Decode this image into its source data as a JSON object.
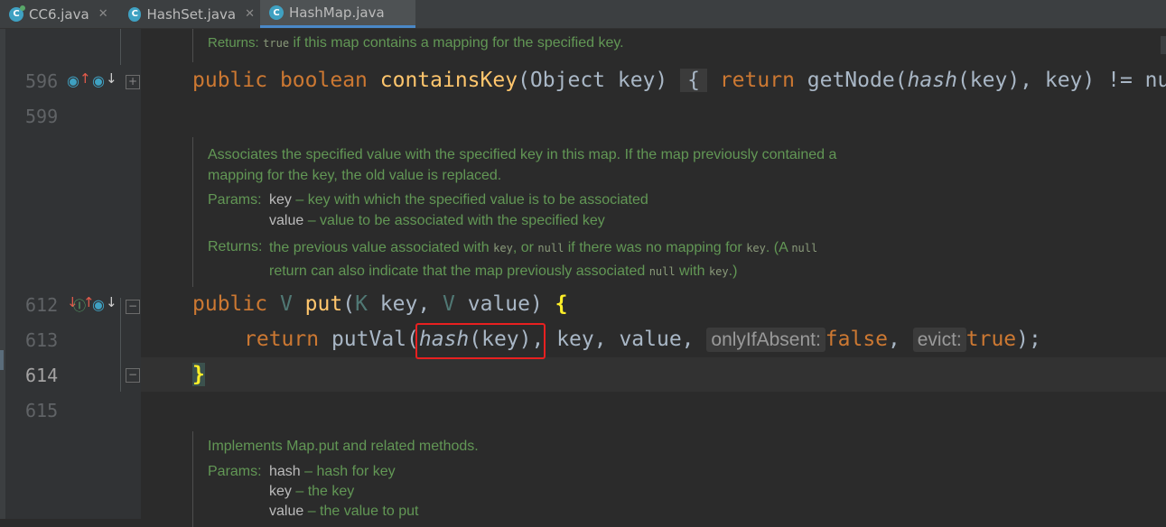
{
  "tabs": [
    {
      "label": "CC6.java",
      "icon": "java-class-icon",
      "active": false
    },
    {
      "label": "HashSet.java",
      "icon": "java-class-icon",
      "active": false
    },
    {
      "label": "HashMap.java",
      "icon": "java-class-icon",
      "active": true
    }
  ],
  "gutter": {
    "lines": [
      "596",
      "599",
      "612",
      "613",
      "614",
      "615"
    ]
  },
  "doc1": {
    "returns_label": "Returns:",
    "returns_code": "true",
    "returns_text": " if this map contains a mapping for the specified key."
  },
  "code596": {
    "kw1": "public",
    "kw2": "boolean",
    "name": "containsKey",
    "params": "(Object key)",
    "fold": "{",
    "kw3": "return",
    "body1": " getNode(",
    "call": "hash",
    "body2": "(key), key) != nu"
  },
  "doc2": {
    "desc1": "Associates the specified value with the specified key in this map. If the map previously contained a",
    "desc2": "mapping for the key, the old value is replaced.",
    "params_label": "Params:",
    "p1_name": "key",
    "p1_desc": " – key with which the specified value is to be associated",
    "p2_name": "value",
    "p2_desc": " – value to be associated with the specified key",
    "returns_label": "Returns:",
    "r1a": "the previous value associated with ",
    "r1_code1": "key",
    "r1b": ", or ",
    "r1_code2": "null",
    "r1c": " if there was no mapping for ",
    "r1_code3": "key",
    "r1d": ". (A ",
    "r1_code4": "null",
    "r2a": "return can also indicate that the map previously associated ",
    "r2_code1": "null",
    "r2b": " with ",
    "r2_code2": "key",
    "r2c": ".)"
  },
  "code612": {
    "kw1": "public",
    "type1": "V",
    "name": "put",
    "p_open": "(",
    "type2": "K",
    "p_key": " key, ",
    "type3": "V",
    "p_val": " value) ",
    "brace": "{"
  },
  "code613": {
    "kw": "return",
    "call": " putVal(",
    "hash": "hash",
    "hash_args": "(key)",
    "rest": ", key, value, ",
    "hint1": "onlyIfAbsent:",
    "v1": "false",
    "sep": ", ",
    "hint2": "evict:",
    "v2": "true",
    "end": ");"
  },
  "code614": {
    "brace": "}"
  },
  "doc3": {
    "desc": "Implements Map.put and related methods.",
    "params_label": "Params:",
    "p1_name": "hash",
    "p1_desc": " – hash for key",
    "p2_name": "key",
    "p2_desc": " – the key",
    "p3_name": "value",
    "p3_desc": " – the value to put"
  }
}
